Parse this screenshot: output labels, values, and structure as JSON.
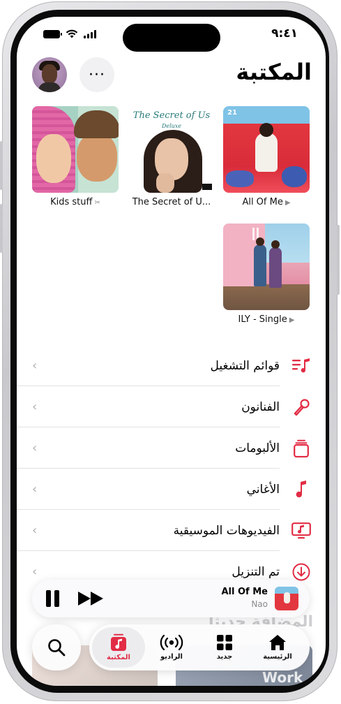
{
  "status_bar": {
    "time": "٩:٤١"
  },
  "header": {
    "title": "المكتبة",
    "more_label": "···"
  },
  "albums": [
    {
      "title": "All Of Me",
      "glyph": "▶"
    },
    {
      "title": "The Secret of U...",
      "art_title": "The Secret of Us",
      "art_subtitle": "Deluxe",
      "glyph": ""
    },
    {
      "title": "Kids stuff",
      "glyph": "✂"
    },
    {
      "title": "ILY - Single",
      "glyph": "▶"
    }
  ],
  "library_list": [
    {
      "label": "قوائم التشغيل",
      "icon": "playlists-icon"
    },
    {
      "label": "الفنانون",
      "icon": "microphone-icon"
    },
    {
      "label": "الألبومات",
      "icon": "album-stack-icon"
    },
    {
      "label": "الأغاني",
      "icon": "music-note-icon"
    },
    {
      "label": "الفيديوهات الموسيقية",
      "icon": "music-video-icon"
    },
    {
      "label": "تم التنزيل",
      "icon": "download-icon"
    }
  ],
  "chevron": "‹",
  "mini_player": {
    "song": "All Of Me",
    "artist": "Nao"
  },
  "peek": {
    "section_title": "المضافة حديثًا",
    "art_word": "Work"
  },
  "tab_bar": {
    "tabs": [
      {
        "label": "الرئيسية",
        "icon": "home-icon",
        "active": false
      },
      {
        "label": "جديد",
        "icon": "grid-icon",
        "active": false
      },
      {
        "label": "الراديو",
        "icon": "radio-icon",
        "active": false
      },
      {
        "label": "المكتبة",
        "icon": "library-icon",
        "active": true
      }
    ]
  },
  "colors": {
    "accent": "#e22c45",
    "text": "#000000",
    "secondary_text": "#8a8a8e"
  }
}
